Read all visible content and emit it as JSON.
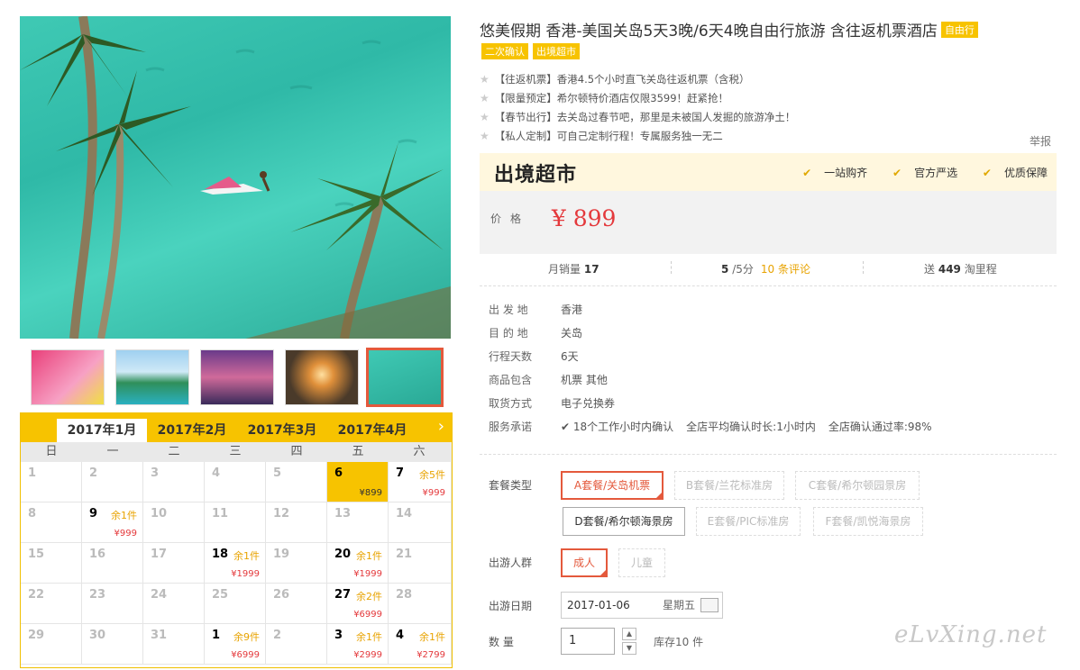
{
  "product": {
    "title": "悠美假期 香港-美国关岛5天3晚/6天4晚自由行旅游 含往返机票酒店",
    "title_tag": "自由行",
    "tags": [
      "二次确认",
      "出境超市"
    ],
    "bullets": [
      "【往返机票】香港4.5个小时直飞关岛往返机票（含税）",
      "【限量预定】希尔顿特价酒店仅限3599！赶紧抢！",
      "【春节出行】去关岛过春节吧，那里是未被国人发掘的旅游净土！",
      "【私人定制】可自己定制行程！专属服务独一无二"
    ],
    "report": "举报"
  },
  "pricebox": {
    "logo": "出境超市",
    "perks": [
      "一站购齐",
      "官方严选",
      "优质保障"
    ],
    "price_label": "价格",
    "price": "¥ 899"
  },
  "stats": {
    "monthly_label": "月销量",
    "monthly": "17",
    "rating": "5",
    "rating_suffix": "/5分",
    "reviews": "10 条评论",
    "points_prefix": "送",
    "points": "449",
    "points_suffix": "淘里程"
  },
  "info": [
    {
      "k": "出 发 地",
      "v": "香港"
    },
    {
      "k": "目 的 地",
      "v": "关岛"
    },
    {
      "k": "行程天数",
      "v": "6天"
    },
    {
      "k": "商品包含",
      "v": "机票  其他"
    },
    {
      "k": "取货方式",
      "v": "电子兑换券"
    }
  ],
  "service": {
    "label": "服务承诺",
    "items": [
      "18个工作小时内确认",
      "全店平均确认时长:1小时内",
      "全店确认通过率:98%"
    ]
  },
  "packages": {
    "label": "套餐类型",
    "options": [
      "A套餐/关岛机票",
      "B套餐/兰花标准房",
      "C套餐/希尔顿园景房",
      "D套餐/希尔顿海景房",
      "E套餐/PIC标准房",
      "F套餐/凯悦海景房"
    ]
  },
  "travelers": {
    "label": "出游人群",
    "options": [
      "成人",
      "儿童"
    ]
  },
  "date": {
    "label": "出游日期",
    "value": "2017-01-06",
    "weekday": "星期五"
  },
  "quantity": {
    "label": "数    量",
    "value": "1",
    "stock": "库存10 件"
  },
  "calendar": {
    "tabs": [
      "2017年1月",
      "2017年2月",
      "2017年3月",
      "2017年4月"
    ],
    "weekdays": [
      "日",
      "一",
      "二",
      "三",
      "四",
      "五",
      "六"
    ],
    "cells": [
      {
        "d": "1"
      },
      {
        "d": "2"
      },
      {
        "d": "3"
      },
      {
        "d": "4"
      },
      {
        "d": "5"
      },
      {
        "d": "6",
        "pr": "¥899",
        "on": true,
        "sel": true
      },
      {
        "d": "7",
        "rem": "余5件",
        "pr": "¥999",
        "on": true
      },
      {
        "d": "8"
      },
      {
        "d": "9",
        "rem": "余1件",
        "pr": "¥999",
        "on": true
      },
      {
        "d": "10"
      },
      {
        "d": "11"
      },
      {
        "d": "12"
      },
      {
        "d": "13"
      },
      {
        "d": "14"
      },
      {
        "d": "15"
      },
      {
        "d": "16"
      },
      {
        "d": "17"
      },
      {
        "d": "18",
        "rem": "余1件",
        "pr": "¥1999",
        "on": true
      },
      {
        "d": "19"
      },
      {
        "d": "20",
        "rem": "余1件",
        "pr": "¥1999",
        "on": true
      },
      {
        "d": "21"
      },
      {
        "d": "22"
      },
      {
        "d": "23"
      },
      {
        "d": "24"
      },
      {
        "d": "25"
      },
      {
        "d": "26"
      },
      {
        "d": "27",
        "rem": "余2件",
        "pr": "¥6999",
        "on": true
      },
      {
        "d": "28"
      },
      {
        "d": "29"
      },
      {
        "d": "30"
      },
      {
        "d": "31"
      },
      {
        "d": "1",
        "rem": "余9件",
        "pr": "¥6999",
        "on": true
      },
      {
        "d": "2"
      },
      {
        "d": "3",
        "rem": "余1件",
        "pr": "¥2999",
        "on": true
      },
      {
        "d": "4",
        "rem": "余1件",
        "pr": "¥2799",
        "on": true
      }
    ]
  },
  "watermark": "eLvXing.net",
  "colors": {
    "accent": "#f7c300",
    "price": "#e4393c",
    "select": "#e4593c"
  }
}
